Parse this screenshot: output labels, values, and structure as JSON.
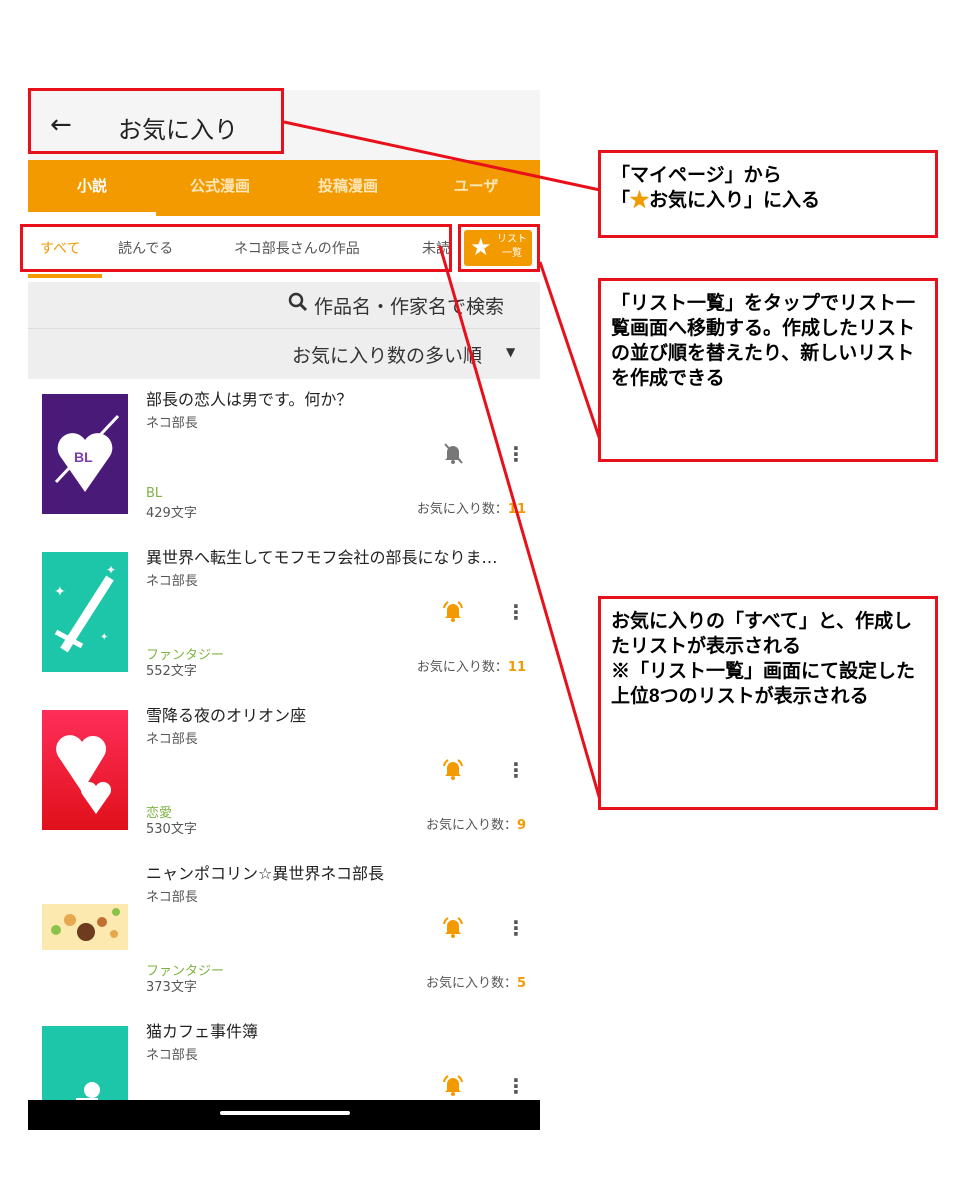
{
  "appbar": {
    "back_icon": "arrow-left-icon",
    "title": "お気に入り"
  },
  "tabs": [
    {
      "label": "小説",
      "active": true
    },
    {
      "label": "公式漫画",
      "active": false
    },
    {
      "label": "投稿漫画",
      "active": false
    },
    {
      "label": "ユーザ",
      "active": false
    }
  ],
  "subtabs": [
    {
      "label": "すべて",
      "active": true
    },
    {
      "label": "読んでる",
      "active": false
    },
    {
      "label": "ネコ部長さんの作品",
      "active": false
    },
    {
      "label": "未読",
      "active": false
    }
  ],
  "list_button": {
    "icon": "star-list-icon",
    "label_line1": "リスト",
    "label_line2": "一覧"
  },
  "search": {
    "icon": "search-icon",
    "placeholder": "作品名・作家名で検索"
  },
  "sort": {
    "label": "お気に入り数の多い順",
    "icon": "caret-down-icon"
  },
  "fav_label": "お気に入り数：",
  "items": [
    {
      "title": "部長の恋人は男です。何か？",
      "author": "ネコ部長",
      "genre": "BL",
      "chars": "429文字",
      "favorites": "11",
      "bell": "bell-off-icon"
    },
    {
      "title": "異世界へ転生してモフモフ会社の部長になりま…",
      "author": "ネコ部長",
      "genre": "ファンタジー",
      "chars": "552文字",
      "favorites": "11",
      "bell": "bell-ringing-icon"
    },
    {
      "title": "雪降る夜のオリオン座",
      "author": "ネコ部長",
      "genre": "恋愛",
      "chars": "530文字",
      "favorites": "9",
      "bell": "bell-ringing-icon"
    },
    {
      "title": "ニャンポコリン☆異世界ネコ部長",
      "author": "ネコ部長",
      "genre": "ファンタジー",
      "chars": "373文字",
      "favorites": "5",
      "bell": "bell-ringing-icon"
    },
    {
      "title": "猫カフェ事件簿",
      "author": "ネコ部長",
      "genre": "",
      "chars": "",
      "favorites": "",
      "bell": "bell-ringing-icon"
    }
  ],
  "annotations": {
    "note1_line1": "「マイページ」から",
    "note1_line2_pre": "「",
    "note1_star": "★",
    "note1_line2_post": "お気に入り」に入る",
    "note2": "「リスト一覧」をタップでリスト一覧画面へ移動する。作成したリストの並び順を替えたり、新しいリストを作成できる",
    "note3": "お気に入りの「すべて」と、作成したリストが表示される\n※「リスト一覧」画面にて設定した上位8つのリストが表示される"
  },
  "colors": {
    "accent": "#f39a00",
    "genre": "#7cb342",
    "annotation": "#e8101a"
  }
}
